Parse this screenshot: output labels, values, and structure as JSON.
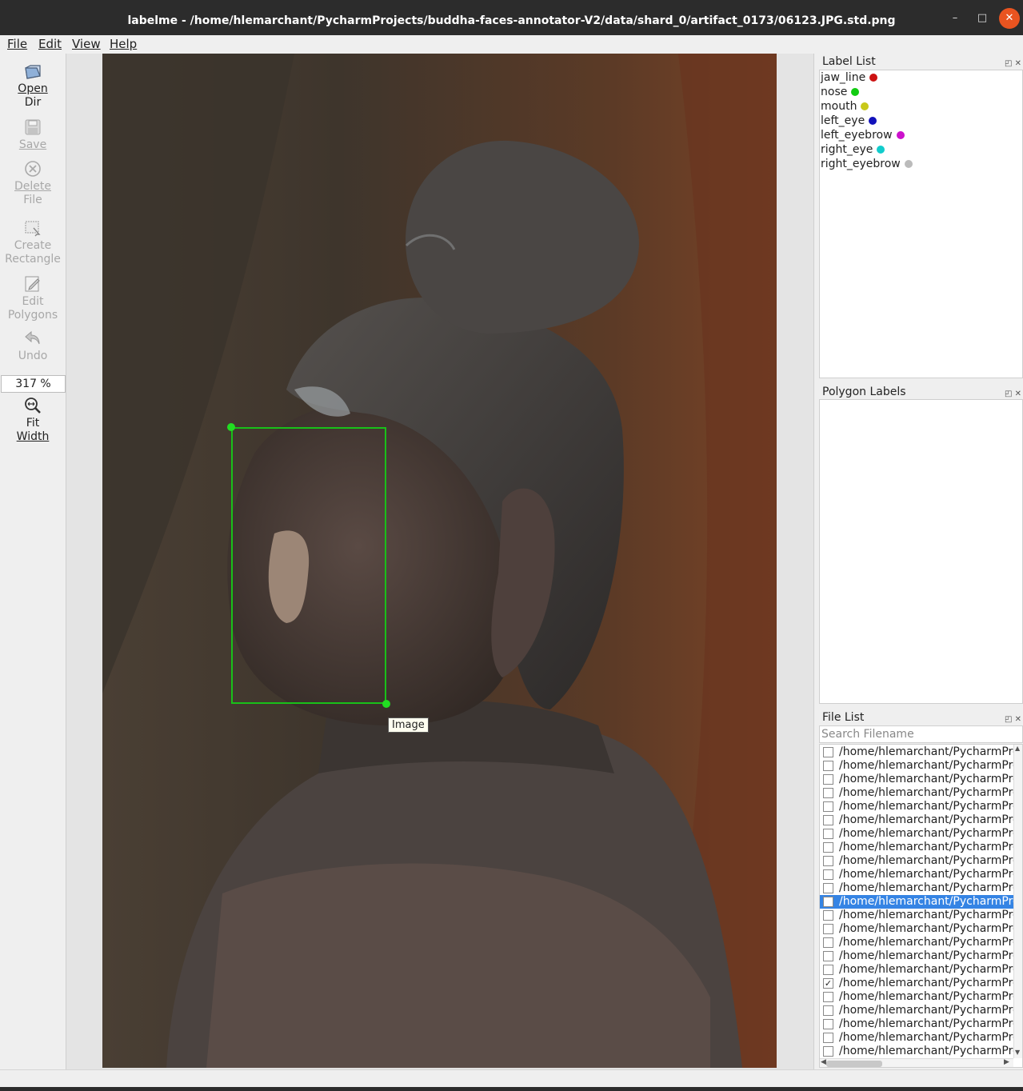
{
  "window": {
    "title": "labelme - /home/hlemarchant/PycharmProjects/buddha-faces-annotator-V2/data/shard_0/artifact_0173/06123.JPG.std.png",
    "min_glyph": "–",
    "max_glyph": "□",
    "close_glyph": "✕"
  },
  "menubar": {
    "file": "File",
    "edit": "Edit",
    "view": "View",
    "help": "Help"
  },
  "toolbar": {
    "open_dir": {
      "line1": "Open",
      "line2": "Dir",
      "icon": "folder-icon",
      "enabled": true
    },
    "save": {
      "line1": "Save",
      "icon": "save-icon",
      "enabled": false
    },
    "delete_file": {
      "line1": "Delete",
      "line2": "File",
      "icon": "delete-icon",
      "enabled": false
    },
    "create_rectangle": {
      "line1": "Create",
      "line2": "Rectangle",
      "icon": "rectangle-icon",
      "enabled": false
    },
    "edit_polygons": {
      "line1": "Edit",
      "line2": "Polygons",
      "icon": "edit-icon",
      "enabled": false
    },
    "undo": {
      "line1": "Undo",
      "icon": "undo-icon",
      "enabled": false
    },
    "zoom_value": "317 %",
    "fit_width": {
      "line1": "Fit",
      "line2": "Width",
      "icon": "zoom-fit-icon",
      "enabled": true
    }
  },
  "canvas": {
    "tooltip": "Image",
    "shape_color": "#19c019",
    "vertex_color": "#22dd22"
  },
  "label_list": {
    "title": "Label List",
    "items": [
      {
        "label": "jaw_line",
        "color": "#cc1111"
      },
      {
        "label": "nose",
        "color": "#11cc11"
      },
      {
        "label": "mouth",
        "color": "#c8c81a"
      },
      {
        "label": "left_eye",
        "color": "#1111bb"
      },
      {
        "label": "left_eyebrow",
        "color": "#cc11cc"
      },
      {
        "label": "right_eye",
        "color": "#11cccc"
      },
      {
        "label": "right_eyebrow",
        "color": "#bbbbbb"
      }
    ]
  },
  "polygon_labels": {
    "title": "Polygon Labels"
  },
  "file_list": {
    "title": "File List",
    "search_placeholder": "Search Filename",
    "rows": [
      {
        "path": "/home/hlemarchant/PycharmPro",
        "checked": false,
        "selected": false
      },
      {
        "path": "/home/hlemarchant/PycharmPro",
        "checked": false,
        "selected": false
      },
      {
        "path": "/home/hlemarchant/PycharmPro",
        "checked": false,
        "selected": false
      },
      {
        "path": "/home/hlemarchant/PycharmPro",
        "checked": false,
        "selected": false
      },
      {
        "path": "/home/hlemarchant/PycharmPro",
        "checked": false,
        "selected": false
      },
      {
        "path": "/home/hlemarchant/PycharmPro",
        "checked": false,
        "selected": false
      },
      {
        "path": "/home/hlemarchant/PycharmPro",
        "checked": false,
        "selected": false
      },
      {
        "path": "/home/hlemarchant/PycharmPro",
        "checked": false,
        "selected": false
      },
      {
        "path": "/home/hlemarchant/PycharmPro",
        "checked": false,
        "selected": false
      },
      {
        "path": "/home/hlemarchant/PycharmPro",
        "checked": false,
        "selected": false
      },
      {
        "path": "/home/hlemarchant/PycharmPro",
        "checked": false,
        "selected": false
      },
      {
        "path": "/home/hlemarchant/PycharmPro",
        "checked": false,
        "selected": true
      },
      {
        "path": "/home/hlemarchant/PycharmPro",
        "checked": false,
        "selected": false
      },
      {
        "path": "/home/hlemarchant/PycharmPro",
        "checked": false,
        "selected": false
      },
      {
        "path": "/home/hlemarchant/PycharmPro",
        "checked": false,
        "selected": false
      },
      {
        "path": "/home/hlemarchant/PycharmPro",
        "checked": false,
        "selected": false
      },
      {
        "path": "/home/hlemarchant/PycharmPro",
        "checked": false,
        "selected": false
      },
      {
        "path": "/home/hlemarchant/PycharmPro",
        "checked": true,
        "selected": false
      },
      {
        "path": "/home/hlemarchant/PycharmPro",
        "checked": false,
        "selected": false
      },
      {
        "path": "/home/hlemarchant/PycharmPro",
        "checked": false,
        "selected": false
      },
      {
        "path": "/home/hlemarchant/PycharmPro",
        "checked": false,
        "selected": false
      },
      {
        "path": "/home/hlemarchant/PycharmPro",
        "checked": false,
        "selected": false
      },
      {
        "path": "/home/hlemarchant/PycharmPro",
        "checked": false,
        "selected": false
      }
    ]
  }
}
